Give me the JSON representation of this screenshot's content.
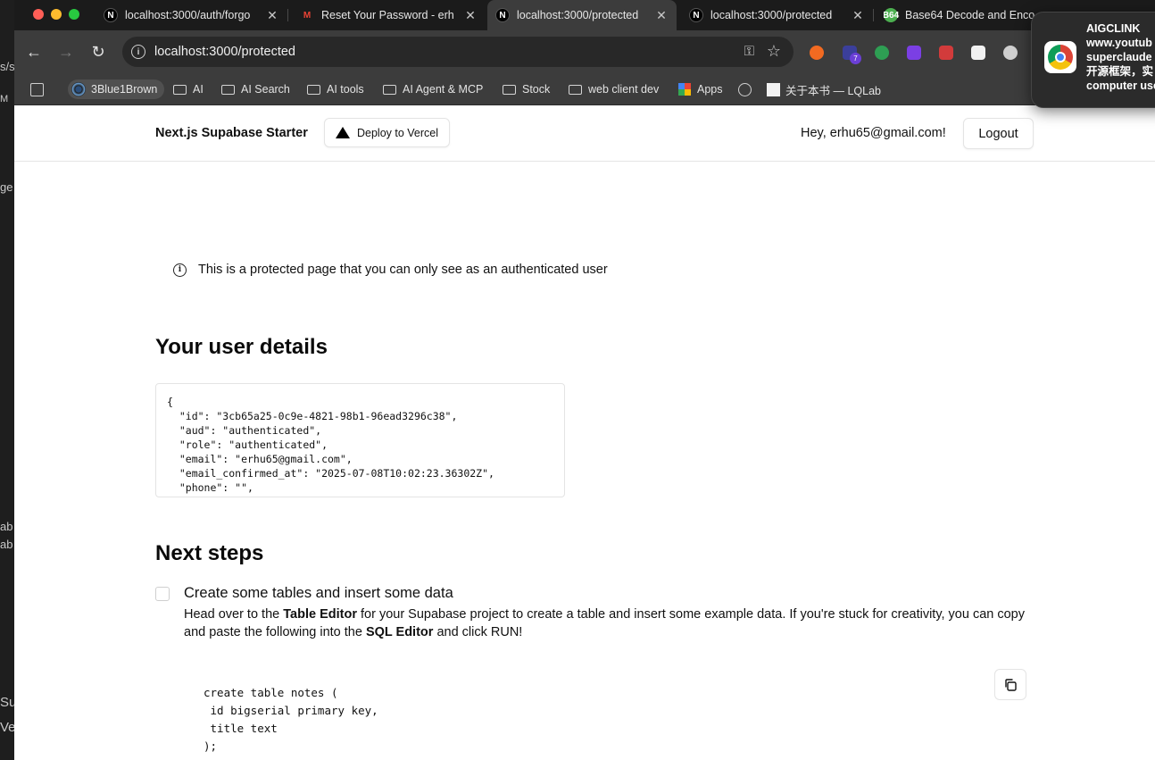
{
  "browser": {
    "tabs": [
      {
        "title": "localhost:3000/auth/forgo",
        "favicon": "nextjs-icon",
        "active": false
      },
      {
        "title": "Reset Your Password - erh",
        "favicon": "gmail-icon",
        "active": false
      },
      {
        "title": "localhost:3000/protected",
        "favicon": "nextjs-icon",
        "active": true
      },
      {
        "title": "localhost:3000/protected",
        "favicon": "nextjs-icon",
        "active": false
      },
      {
        "title": "Base64 Decode and Enco",
        "favicon": "b64-icon",
        "active": false
      }
    ],
    "b64_favicon_text": "B64",
    "url": "localhost:3000/protected",
    "extension_badge": "7",
    "bookmarks": [
      "3Blue1Brown",
      "AI",
      "AI Search",
      "AI tools",
      "AI Agent & MCP",
      "Stock",
      "web client dev",
      "Apps",
      "关于本书 — LQLab"
    ]
  },
  "notification": {
    "lines": [
      "AIGCLINK",
      "www.youtub",
      "superclaude",
      "开源框架，实",
      "computer use"
    ]
  },
  "left_strip": [
    "s/s",
    "M",
    "ge",
    "ab",
    "ab",
    "Su",
    "Ve"
  ],
  "header": {
    "brand": "Next.js Supabase Starter",
    "deploy_label": "Deploy to Vercel",
    "greeting": "Hey, erhu65@gmail.com!",
    "logout_label": "Logout"
  },
  "notice": "This is a protected page that you can only see as an authenticated user",
  "user_details": {
    "heading": "Your user details",
    "json_text": "{\n  \"id\": \"3cb65a25-0c9e-4821-98b1-96ead3296c38\",\n  \"aud\": \"authenticated\",\n  \"role\": \"authenticated\",\n  \"email\": \"erhu65@gmail.com\",\n  \"email_confirmed_at\": \"2025-07-08T10:02:23.36302Z\",\n  \"phone\": \"\","
  },
  "next_steps": {
    "heading": "Next steps",
    "step_title": "Create some tables and insert some data",
    "desc_1": "Head over to the ",
    "desc_bold_1": "Table Editor",
    "desc_2": " for your Supabase project to create a table and insert some example data. If you're stuck for creativity, you can copy and paste the following into the ",
    "desc_bold_2": "SQL Editor",
    "desc_3": " and click RUN!",
    "code": "create table notes (\n id bigserial primary key,\n title text\n);"
  }
}
